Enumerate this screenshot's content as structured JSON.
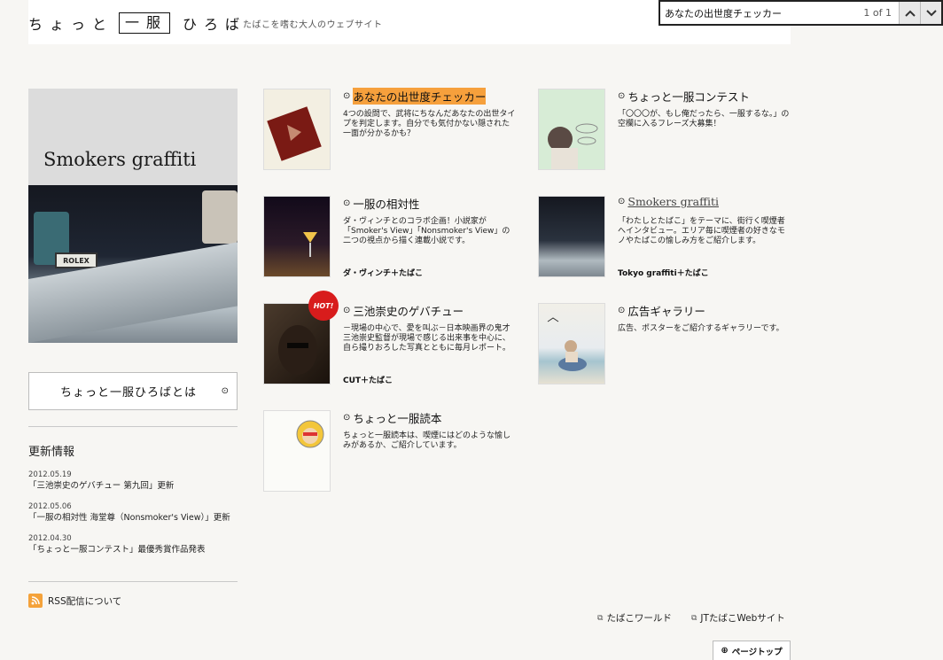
{
  "header": {
    "logo_part1": "ちょっと",
    "logo_box": "一服",
    "logo_part2": "ひろば",
    "tagline": "たばこを嗜む大人のウェブサイト"
  },
  "findbar": {
    "value": "あなたの出世度チェッカー",
    "count": "1 of 1",
    "prev_icon": "chevron-up-icon",
    "next_icon": "chevron-down-icon"
  },
  "hero": {
    "title": "Smokers graffiti",
    "sign": "ROLEX"
  },
  "about": {
    "label": "ちょっと一服ひろばとは",
    "arrow": "⊙"
  },
  "news": {
    "heading": "更新情報",
    "items": [
      {
        "date": "2012.05.19",
        "text": "「三池崇史のゲバチュー 第九回」更新"
      },
      {
        "date": "2012.05.06",
        "text": "「一服の相対性 海堂尊（Nonsmoker's View）」更新"
      },
      {
        "date": "2012.04.30",
        "text": "「ちょっと一服コンテスト」最優秀賞作品発表"
      }
    ]
  },
  "rss": {
    "label": "RSS配信について"
  },
  "cards": [
    {
      "title": "あなたの出世度チェッカー",
      "desc": "4つの設問で、武将にちなんだあなたの出世タイプを判定します。自分でも気付かない隠された一面が分かるかも？",
      "credit": ""
    },
    {
      "title": "ちょっと一服コンテスト",
      "desc": "「〇〇〇が、もし俺だったら、一服するな。」の空欄に入るフレーズ大募集！",
      "credit": ""
    },
    {
      "title": "一服の相対性",
      "desc": "ダ・ヴィンチとのコラボ企画！小説家が「Smoker's View」「Nonsmoker's View」の二つの視点から描く連載小説です。",
      "credit": "ダ・ヴィンチ＋たばこ"
    },
    {
      "title": "Smokers graffiti",
      "desc": "「わたしとたばこ」をテーマに、街行く喫煙者へインタビュー。エリア毎に喫煙者の好きなモノやたばこの愉しみ方をご紹介します。",
      "credit": "Tokyo graffiti＋たばこ"
    },
    {
      "title": "三池崇史のゲバチュー",
      "desc": "－現場の中心で、愛を叫ぶ－日本映画界の鬼才 三池崇史監督が現場で感じる出来事を中心に、自ら撮りおろした写真とともに毎月レポート。",
      "credit": "CUT＋たばこ",
      "badge": "HOT!"
    },
    {
      "title": "広告ギャラリー",
      "desc": "広告、ポスターをご紹介するギャラリーです。",
      "credit": ""
    },
    {
      "title": "ちょっと一服読本",
      "desc": "ちょっと一服読本は、喫煙にはどのような愉しみがあるか、ご紹介しています。",
      "credit": ""
    }
  ],
  "footer": {
    "link1": "たばこワールド",
    "link2": "JTたばこWebサイト",
    "pagetop": "ページトップ"
  },
  "colors": {
    "highlight": "#f6a03c",
    "hot_badge": "#d81c1c",
    "background": "#f7f6f3"
  }
}
